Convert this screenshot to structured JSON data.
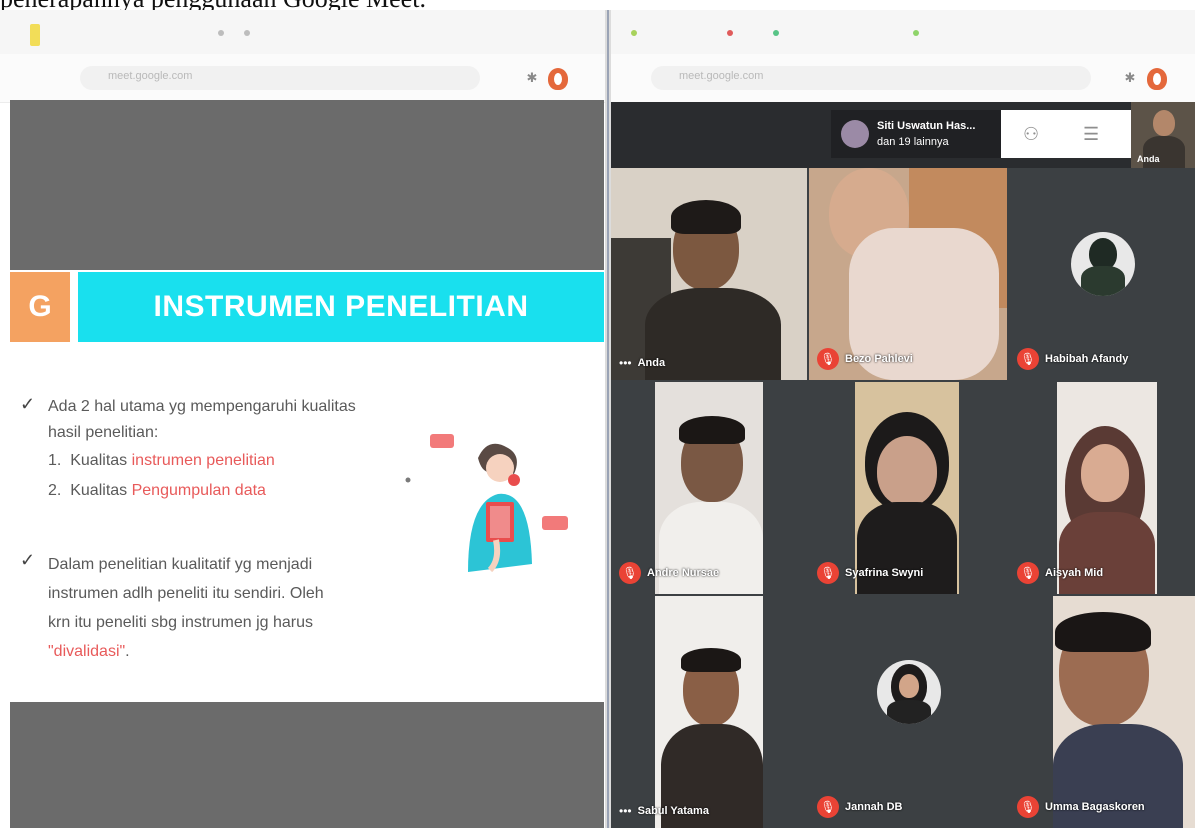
{
  "caption": "penerapannya  penggunaan  Google  Meet.",
  "left_browser": {
    "address_text": "meet.google.com"
  },
  "slide": {
    "section_letter": "G",
    "title": "INSTRUMEN PENELITIAN",
    "bullet1_line1": "Ada 2 hal utama yg mempengaruhi kualitas",
    "bullet1_line2": "hasil penelitian:",
    "item1_num": "1.",
    "item1_prefix": "Kualitas ",
    "item1_highlight": "instrumen penelitian",
    "item2_num": "2.",
    "item2_prefix": "Kualitas ",
    "item2_highlight": "Pengumpulan data",
    "bullet2_line1": "Dalam penelitian kualitatif yg menjadi",
    "bullet2_line2": "instrumen adlh peneliti itu sendiri. Oleh",
    "bullet2_line3": "krn itu peneliti sbg instrumen jg harus",
    "bullet2_line4_highlight": "\"divalidasi\"",
    "bullet2_line4_suffix": "."
  },
  "meet": {
    "people_chip_line1": "Siti Uswatun Has...",
    "people_chip_line2": "dan 19 lainnya",
    "self_label": "Anda",
    "participants": [
      {
        "name": "Anda",
        "muted": false
      },
      {
        "name": "Bezo Pahlevi",
        "muted": true
      },
      {
        "name": "Habibah Afandy",
        "muted": true
      },
      {
        "name": "Andre Nursae",
        "muted": true
      },
      {
        "name": "Syafrina Swyni",
        "muted": true
      },
      {
        "name": "Aisyah Mid",
        "muted": true
      },
      {
        "name": "Sabul Yatama",
        "muted": false
      },
      {
        "name": "Jannah DB",
        "muted": true
      },
      {
        "name": "Umma Bagaskoren",
        "muted": true
      }
    ]
  },
  "colors": {
    "accent_cyan": "#19e0ee",
    "accent_orange": "#f4a261",
    "highlight_red": "#e85a5a",
    "mic_red": "#ea4335",
    "meet_bg": "#3c4043"
  }
}
